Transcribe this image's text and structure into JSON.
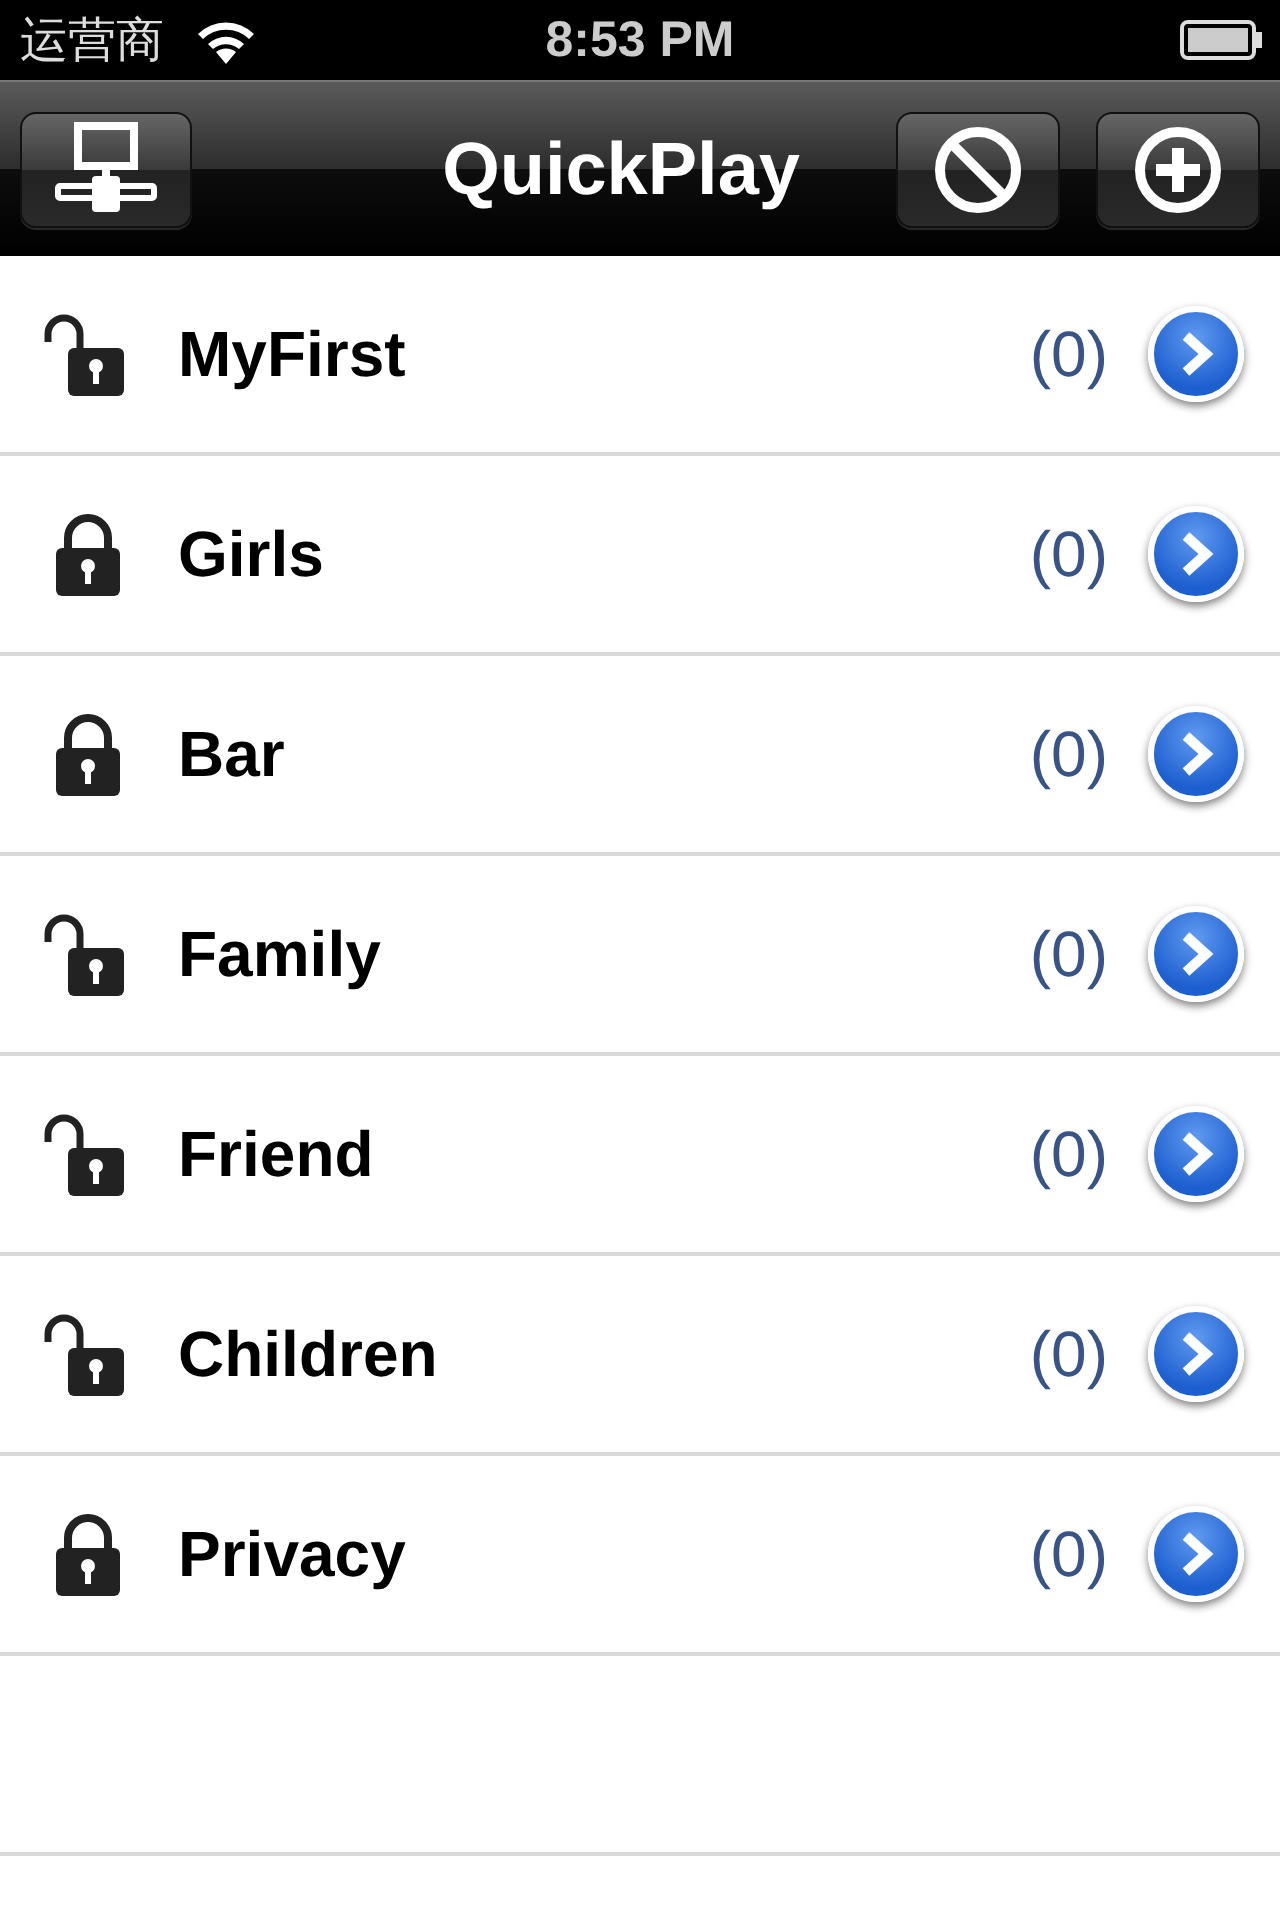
{
  "status_bar": {
    "carrier": "运营商",
    "time": "8:53 PM"
  },
  "nav_bar": {
    "title": "QuickPlay"
  },
  "rows": [
    {
      "label": "MyFirst",
      "count": "(0)",
      "locked": false
    },
    {
      "label": "Girls",
      "count": "(0)",
      "locked": true
    },
    {
      "label": "Bar",
      "count": "(0)",
      "locked": true
    },
    {
      "label": "Family",
      "count": "(0)",
      "locked": false
    },
    {
      "label": "Friend",
      "count": "(0)",
      "locked": false
    },
    {
      "label": "Children",
      "count": "(0)",
      "locked": false
    },
    {
      "label": "Privacy",
      "count": "(0)",
      "locked": true
    }
  ]
}
